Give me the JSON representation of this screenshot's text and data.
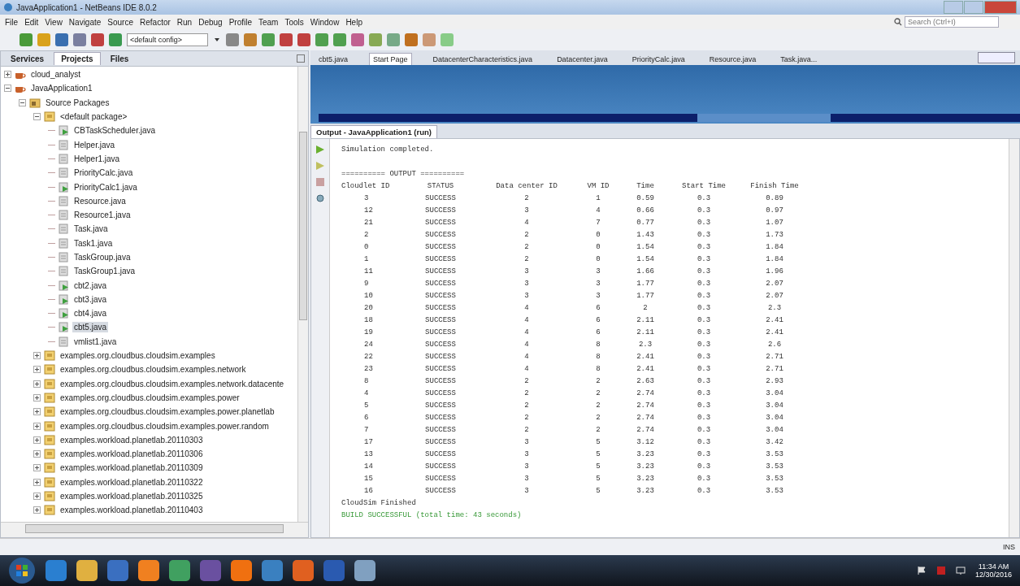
{
  "window": {
    "title": "JavaApplication1 - NetBeans IDE 8.0.2"
  },
  "menu": [
    "File",
    "Edit",
    "View",
    "Navigate",
    "Source",
    "Refactor",
    "Run",
    "Debug",
    "Profile",
    "Team",
    "Tools",
    "Window",
    "Help"
  ],
  "search": {
    "placeholder": "Search (Ctrl+I)"
  },
  "toolbar": {
    "config": "<default config>"
  },
  "left_tabs": [
    {
      "label": "Services",
      "selected": false
    },
    {
      "label": "Projects",
      "selected": true
    },
    {
      "label": "Files",
      "selected": false
    }
  ],
  "tree": [
    {
      "label": "cloud_analyst",
      "kind": "project",
      "expanded": false,
      "selected": false
    },
    {
      "label": "JavaApplication1",
      "kind": "project",
      "expanded": true,
      "selected": false,
      "children": [
        {
          "label": "Source Packages",
          "kind": "sources",
          "expanded": true,
          "selected": false,
          "children": [
            {
              "label": "<default package>",
              "kind": "package",
              "expanded": true,
              "selected": false,
              "children": [
                {
                  "label": "CBTaskScheduler.java",
                  "kind": "main",
                  "selected": false
                },
                {
                  "label": "Helper.java",
                  "kind": "class",
                  "selected": false
                },
                {
                  "label": "Helper1.java",
                  "kind": "class",
                  "selected": false
                },
                {
                  "label": "PriorityCalc.java",
                  "kind": "class",
                  "selected": false
                },
                {
                  "label": "PriorityCalc1.java",
                  "kind": "main",
                  "selected": false
                },
                {
                  "label": "Resource.java",
                  "kind": "class",
                  "selected": false
                },
                {
                  "label": "Resource1.java",
                  "kind": "class",
                  "selected": false
                },
                {
                  "label": "Task.java",
                  "kind": "class",
                  "selected": false
                },
                {
                  "label": "Task1.java",
                  "kind": "class",
                  "selected": false
                },
                {
                  "label": "TaskGroup.java",
                  "kind": "class",
                  "selected": false
                },
                {
                  "label": "TaskGroup1.java",
                  "kind": "class",
                  "selected": false
                },
                {
                  "label": "cbt2.java",
                  "kind": "main",
                  "selected": false
                },
                {
                  "label": "cbt3.java",
                  "kind": "main",
                  "selected": false
                },
                {
                  "label": "cbt4.java",
                  "kind": "main",
                  "selected": false
                },
                {
                  "label": "cbt5.java",
                  "kind": "main",
                  "selected": true
                },
                {
                  "label": "vmlist1.java",
                  "kind": "class",
                  "selected": false
                }
              ]
            },
            {
              "label": "examples.org.cloudbus.cloudsim.examples",
              "kind": "package",
              "expanded": false,
              "selected": false
            },
            {
              "label": "examples.org.cloudbus.cloudsim.examples.network",
              "kind": "package",
              "expanded": false,
              "selected": false
            },
            {
              "label": "examples.org.cloudbus.cloudsim.examples.network.datacente",
              "kind": "package",
              "expanded": false,
              "selected": false
            },
            {
              "label": "examples.org.cloudbus.cloudsim.examples.power",
              "kind": "package",
              "expanded": false,
              "selected": false
            },
            {
              "label": "examples.org.cloudbus.cloudsim.examples.power.planetlab",
              "kind": "package",
              "expanded": false,
              "selected": false
            },
            {
              "label": "examples.org.cloudbus.cloudsim.examples.power.random",
              "kind": "package",
              "expanded": false,
              "selected": false
            },
            {
              "label": "examples.workload.planetlab.20110303",
              "kind": "package",
              "expanded": false,
              "selected": false
            },
            {
              "label": "examples.workload.planetlab.20110306",
              "kind": "package",
              "expanded": false,
              "selected": false
            },
            {
              "label": "examples.workload.planetlab.20110309",
              "kind": "package",
              "expanded": false,
              "selected": false
            },
            {
              "label": "examples.workload.planetlab.20110322",
              "kind": "package",
              "expanded": false,
              "selected": false
            },
            {
              "label": "examples.workload.planetlab.20110325",
              "kind": "package",
              "expanded": false,
              "selected": false
            },
            {
              "label": "examples.workload.planetlab.20110403",
              "kind": "package",
              "expanded": false,
              "selected": false
            }
          ]
        }
      ]
    }
  ],
  "editor_tabs": [
    {
      "label": "cbt5.java",
      "selected": false
    },
    {
      "label": "Start Page",
      "selected": true
    },
    {
      "label": "DatacenterCharacteristics.java",
      "selected": false
    },
    {
      "label": "Datacenter.java",
      "selected": false
    },
    {
      "label": "PriorityCalc.java",
      "selected": false
    },
    {
      "label": "Resource.java",
      "selected": false
    },
    {
      "label": "Task.java...",
      "selected": false
    }
  ],
  "output": {
    "title": "Output - JavaApplication1 (run)",
    "lines_before": [
      "Simulation completed.",
      "========== OUTPUT =========="
    ],
    "columns": [
      "Cloudlet ID",
      "STATUS",
      "Data center ID",
      "VM ID",
      "Time",
      "Start Time",
      "Finish Time"
    ],
    "rows": [
      [
        "3",
        "SUCCESS",
        "2",
        "1",
        "0.59",
        "0.3",
        "0.89"
      ],
      [
        "12",
        "SUCCESS",
        "3",
        "4",
        "0.66",
        "0.3",
        "0.97"
      ],
      [
        "21",
        "SUCCESS",
        "4",
        "7",
        "0.77",
        "0.3",
        "1.07"
      ],
      [
        "2",
        "SUCCESS",
        "2",
        "0",
        "1.43",
        "0.3",
        "1.73"
      ],
      [
        "0",
        "SUCCESS",
        "2",
        "0",
        "1.54",
        "0.3",
        "1.84"
      ],
      [
        "1",
        "SUCCESS",
        "2",
        "0",
        "1.54",
        "0.3",
        "1.84"
      ],
      [
        "11",
        "SUCCESS",
        "3",
        "3",
        "1.66",
        "0.3",
        "1.96"
      ],
      [
        "9",
        "SUCCESS",
        "3",
        "3",
        "1.77",
        "0.3",
        "2.07"
      ],
      [
        "10",
        "SUCCESS",
        "3",
        "3",
        "1.77",
        "0.3",
        "2.07"
      ],
      [
        "20",
        "SUCCESS",
        "4",
        "6",
        "2",
        "0.3",
        "2.3"
      ],
      [
        "18",
        "SUCCESS",
        "4",
        "6",
        "2.11",
        "0.3",
        "2.41"
      ],
      [
        "19",
        "SUCCESS",
        "4",
        "6",
        "2.11",
        "0.3",
        "2.41"
      ],
      [
        "24",
        "SUCCESS",
        "4",
        "8",
        "2.3",
        "0.3",
        "2.6"
      ],
      [
        "22",
        "SUCCESS",
        "4",
        "8",
        "2.41",
        "0.3",
        "2.71"
      ],
      [
        "23",
        "SUCCESS",
        "4",
        "8",
        "2.41",
        "0.3",
        "2.71"
      ],
      [
        "8",
        "SUCCESS",
        "2",
        "2",
        "2.63",
        "0.3",
        "2.93"
      ],
      [
        "4",
        "SUCCESS",
        "2",
        "2",
        "2.74",
        "0.3",
        "3.04"
      ],
      [
        "5",
        "SUCCESS",
        "2",
        "2",
        "2.74",
        "0.3",
        "3.04"
      ],
      [
        "6",
        "SUCCESS",
        "2",
        "2",
        "2.74",
        "0.3",
        "3.04"
      ],
      [
        "7",
        "SUCCESS",
        "2",
        "2",
        "2.74",
        "0.3",
        "3.04"
      ],
      [
        "17",
        "SUCCESS",
        "3",
        "5",
        "3.12",
        "0.3",
        "3.42"
      ],
      [
        "13",
        "SUCCESS",
        "3",
        "5",
        "3.23",
        "0.3",
        "3.53"
      ],
      [
        "14",
        "SUCCESS",
        "3",
        "5",
        "3.23",
        "0.3",
        "3.53"
      ],
      [
        "15",
        "SUCCESS",
        "3",
        "5",
        "3.23",
        "0.3",
        "3.53"
      ],
      [
        "16",
        "SUCCESS",
        "3",
        "5",
        "3.23",
        "0.3",
        "3.53"
      ]
    ],
    "lines_after": [
      {
        "text": "CloudSim Finished",
        "kind": "plain"
      },
      {
        "text": "BUILD SUCCESSFUL (total time: 43 seconds)",
        "kind": "success"
      }
    ]
  },
  "status_bar": {
    "mode": "INS"
  },
  "taskbar": {
    "time": "11:34 AM",
    "date": "12/30/2016"
  }
}
